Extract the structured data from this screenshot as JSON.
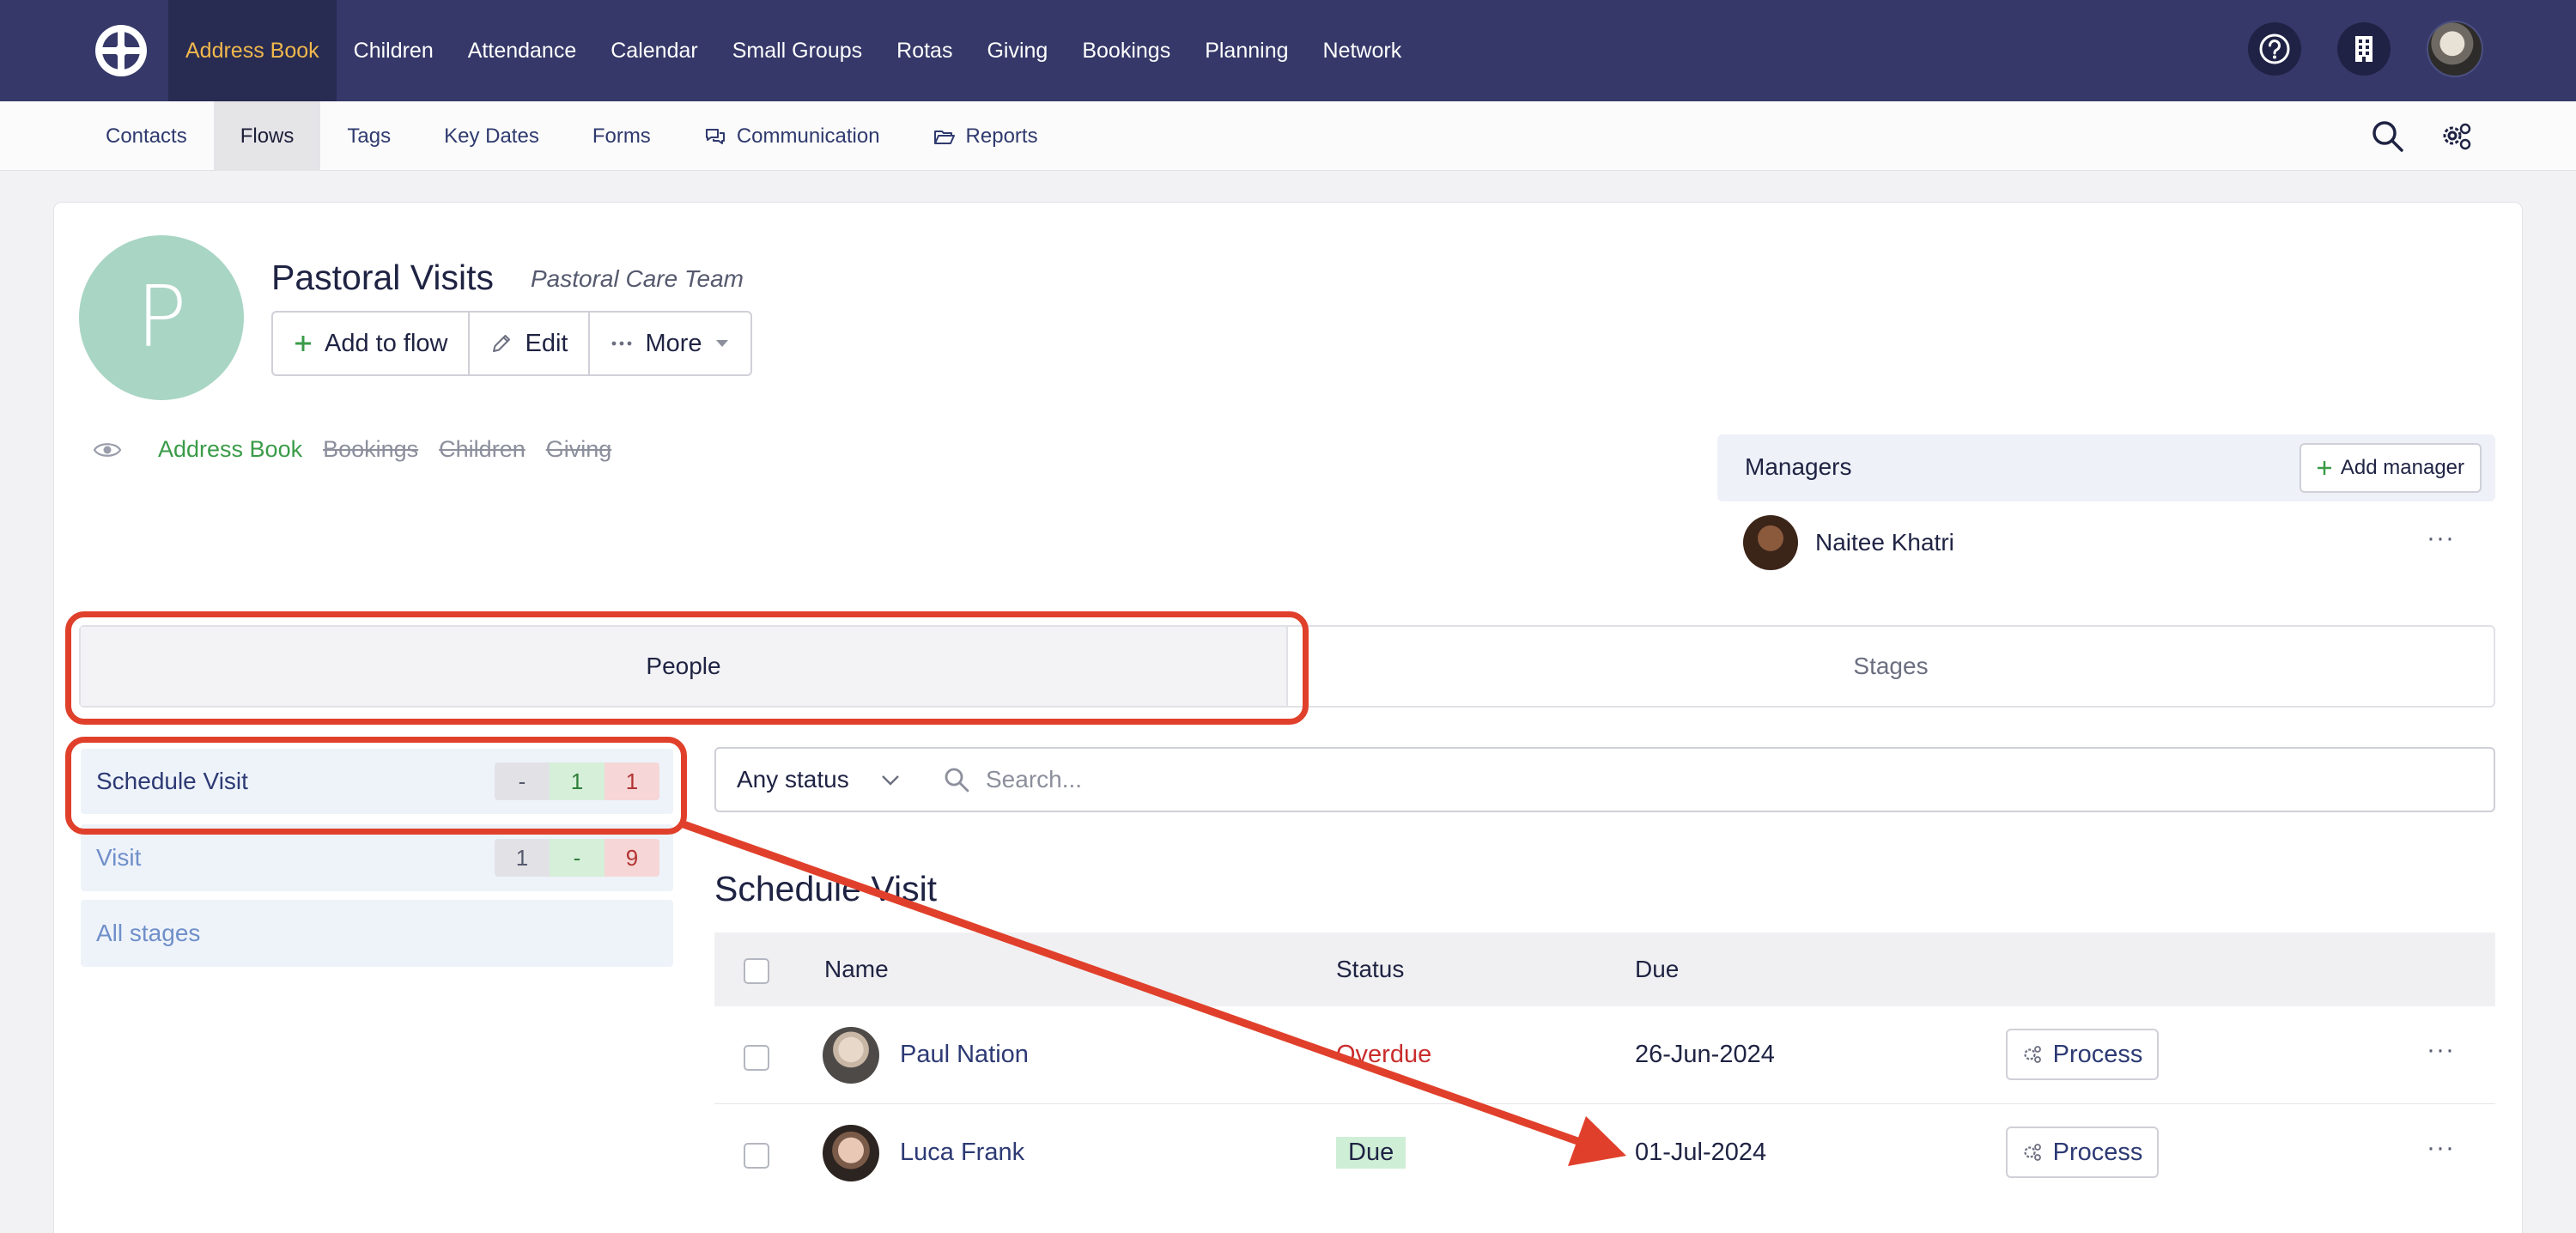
{
  "topnav": {
    "items": [
      "Address Book",
      "Children",
      "Attendance",
      "Calendar",
      "Small Groups",
      "Rotas",
      "Giving",
      "Bookings",
      "Planning",
      "Network"
    ],
    "active": "Address Book"
  },
  "subnav": {
    "items": [
      "Contacts",
      "Flows",
      "Tags",
      "Key Dates",
      "Forms",
      "Communication",
      "Reports"
    ],
    "active": "Flows"
  },
  "flow": {
    "avatar_letter": "P",
    "title": "Pastoral Visits",
    "team": "Pastoral Care Team",
    "buttons": {
      "add": "Add to flow",
      "edit": "Edit",
      "more": "More"
    },
    "visibility": {
      "on": [
        "Address Book"
      ],
      "off": [
        "Bookings",
        "Children",
        "Giving"
      ]
    }
  },
  "managers": {
    "title": "Managers",
    "add_label": "Add manager",
    "list": [
      {
        "name": "Naitee Khatri"
      }
    ]
  },
  "tabs": {
    "people": "People",
    "stages": "Stages"
  },
  "stages": [
    {
      "name": "Schedule Visit",
      "counts": [
        "-",
        "1",
        "1"
      ]
    },
    {
      "name": "Visit",
      "counts": [
        "1",
        "-",
        "9"
      ]
    },
    {
      "name": "All stages"
    }
  ],
  "filters": {
    "status": "Any status",
    "search_placeholder": "Search..."
  },
  "section_title": "Schedule Visit",
  "table": {
    "columns": [
      "Name",
      "Status",
      "Due"
    ],
    "rows": [
      {
        "name": "Paul Nation",
        "status": "Overdue",
        "due": "26-Jun-2024",
        "action": "Process"
      },
      {
        "name": "Luca Frank",
        "status": "Due",
        "due": "01-Jul-2024",
        "action": "Process"
      }
    ]
  },
  "colors": {
    "nav_bg": "#353868",
    "nav_active_text": "#f0b84c",
    "annotation": "#e0402b",
    "overdue": "#c92c2c",
    "visible_link": "#3a9b48"
  }
}
